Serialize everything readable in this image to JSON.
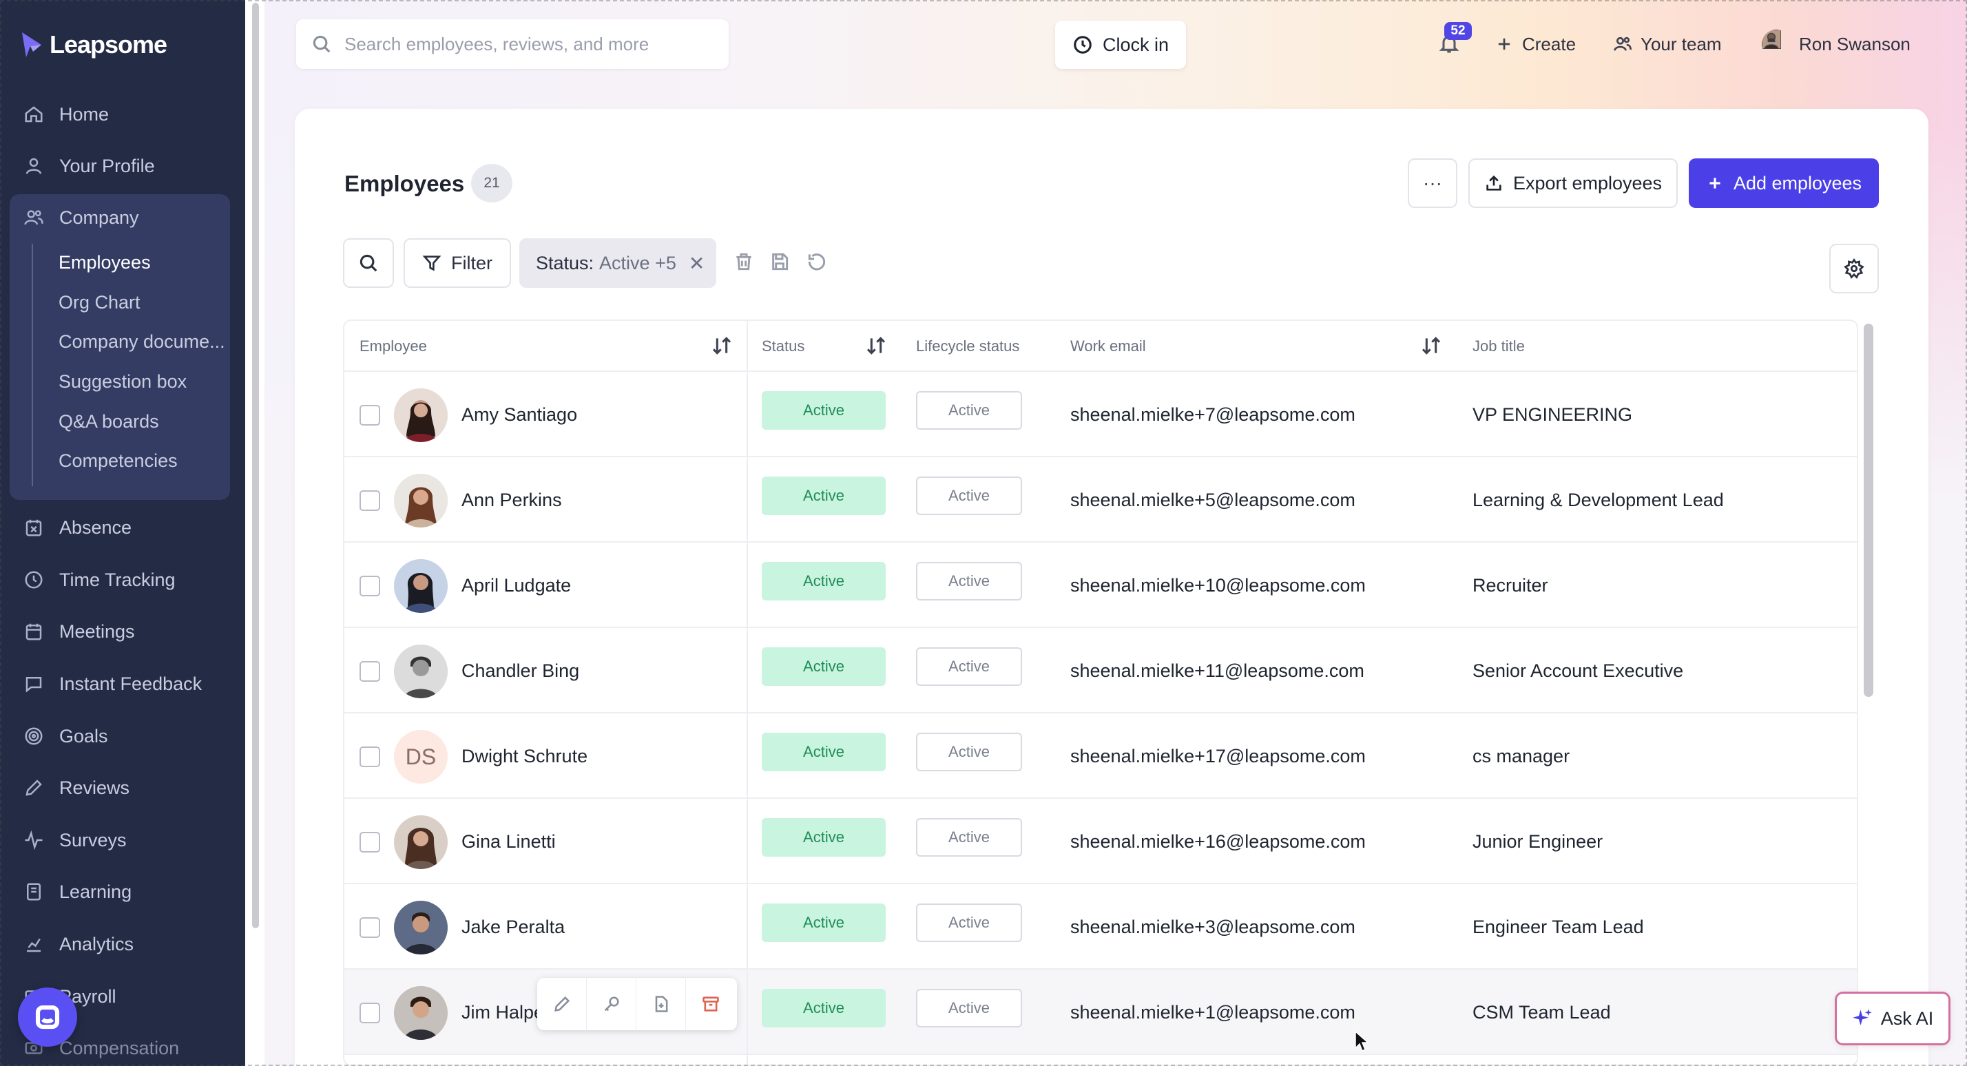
{
  "app": {
    "brand": "Leapsome"
  },
  "sidebar": {
    "items": [
      {
        "label": "Home",
        "icon": "home-icon"
      },
      {
        "label": "Your Profile",
        "icon": "user-icon"
      },
      {
        "label": "Company",
        "icon": "users-icon"
      },
      {
        "label": "Absence",
        "icon": "calendar-x-icon"
      },
      {
        "label": "Time Tracking",
        "icon": "clock-icon"
      },
      {
        "label": "Meetings",
        "icon": "calendar-icon"
      },
      {
        "label": "Instant Feedback",
        "icon": "chat-icon"
      },
      {
        "label": "Goals",
        "icon": "target-icon"
      },
      {
        "label": "Reviews",
        "icon": "pencil-icon"
      },
      {
        "label": "Surveys",
        "icon": "pulse-icon"
      },
      {
        "label": "Learning",
        "icon": "book-icon"
      },
      {
        "label": "Analytics",
        "icon": "chart-icon"
      },
      {
        "label": "Payroll",
        "icon": "wallet-icon"
      },
      {
        "label": "Compensation",
        "icon": "money-icon"
      }
    ],
    "company_sub": [
      "Employees",
      "Org Chart",
      "Company docume...",
      "Suggestion box",
      "Q&A boards",
      "Competencies"
    ],
    "active_sub": "Employees"
  },
  "topbar": {
    "search_placeholder": "Search employees, reviews, and more",
    "clock_in": "Clock in",
    "notifications_count": "52",
    "create": "Create",
    "your_team": "Your team",
    "user_name": "Ron Swanson"
  },
  "page": {
    "title": "Employees",
    "count": "21",
    "more": "···",
    "export": "Export employees",
    "add": "Add employees",
    "filter": "Filter",
    "chip_key": "Status:",
    "chip_value": "Active +5",
    "chip_close": "✕"
  },
  "table": {
    "headers": {
      "employee": "Employee",
      "status": "Status",
      "lifecycle": "Lifecycle status",
      "email": "Work email",
      "job": "Job title"
    },
    "rows": [
      {
        "name": "Amy Santiago",
        "status": "Active",
        "lifecycle": "Active",
        "email": "sheenal.mielke+7@leapsome.com",
        "job": "VP ENGINEERING",
        "avatar_color": "#7a4a3a"
      },
      {
        "name": "Ann Perkins",
        "status": "Active",
        "lifecycle": "Active",
        "email": "sheenal.mielke+5@leapsome.com",
        "job": "Learning & Development Lead",
        "avatar_color": "#8b5a45"
      },
      {
        "name": "April Ludgate",
        "status": "Active",
        "lifecycle": "Active",
        "email": "sheenal.mielke+10@leapsome.com",
        "job": "Recruiter",
        "avatar_color": "#3b3d55"
      },
      {
        "name": "Chandler Bing",
        "status": "Active",
        "lifecycle": "Active",
        "email": "sheenal.mielke+11@leapsome.com",
        "job": "Senior Account Executive",
        "avatar_color": "#6a6a6a"
      },
      {
        "name": "Dwight Schrute",
        "status": "Active",
        "lifecycle": "Active",
        "email": "sheenal.mielke+17@leapsome.com",
        "job": "cs manager",
        "initials": "DS"
      },
      {
        "name": "Gina Linetti",
        "status": "Active",
        "lifecycle": "Active",
        "email": "sheenal.mielke+16@leapsome.com",
        "job": "Junior Engineer",
        "avatar_color": "#5a4038"
      },
      {
        "name": "Jake Peralta",
        "status": "Active",
        "lifecycle": "Active",
        "email": "sheenal.mielke+3@leapsome.com",
        "job": "Engineer Team Lead",
        "avatar_color": "#3c4150"
      },
      {
        "name": "Jim Halpe",
        "status": "Active",
        "lifecycle": "Active",
        "email": "sheenal.mielke+1@leapsome.com",
        "job": "CSM Team Lead",
        "avatar_color": "#4a3a32"
      }
    ]
  },
  "ask_ai": "Ask AI",
  "colors": {
    "sidebar_bg": "#242b45",
    "accent": "#4b3fe8",
    "status_green_bg": "#c9f4df",
    "status_green_text": "#1f8c57"
  }
}
